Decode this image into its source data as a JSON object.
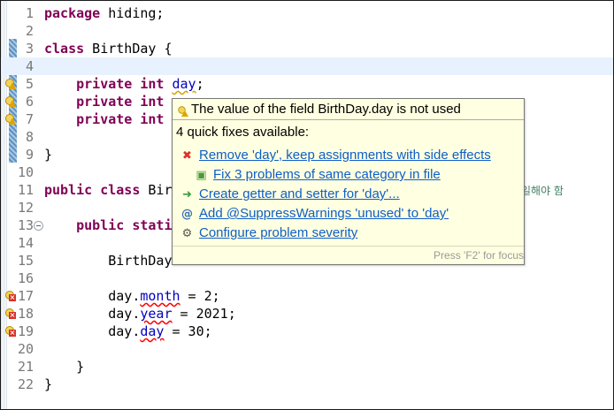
{
  "editor": {
    "lines": [
      {
        "num": "1",
        "tokens": [
          {
            "t": "package",
            "c": "kw"
          },
          {
            "t": " hiding;"
          }
        ]
      },
      {
        "num": "2",
        "tokens": []
      },
      {
        "num": "3",
        "tokens": [
          {
            "t": "class",
            "c": "kw"
          },
          {
            "t": " BirthDay {"
          }
        ]
      },
      {
        "num": "4",
        "tokens": [],
        "current": true
      },
      {
        "num": "5",
        "tokens": [
          {
            "t": "    "
          },
          {
            "t": "private",
            "c": "kw"
          },
          {
            "t": " "
          },
          {
            "t": "int",
            "c": "kw"
          },
          {
            "t": " "
          },
          {
            "t": "day",
            "c": "warnfld"
          },
          {
            "t": ";"
          }
        ],
        "gutter": "warn"
      },
      {
        "num": "6",
        "tokens": [
          {
            "t": "    "
          },
          {
            "t": "private",
            "c": "kw"
          },
          {
            "t": " "
          },
          {
            "t": "int",
            "c": "kw"
          }
        ],
        "gutter": "warn"
      },
      {
        "num": "7",
        "tokens": [
          {
            "t": "    "
          },
          {
            "t": "private",
            "c": "kw"
          },
          {
            "t": " "
          },
          {
            "t": "int",
            "c": "kw"
          }
        ],
        "gutter": "warn"
      },
      {
        "num": "8",
        "tokens": []
      },
      {
        "num": "9",
        "tokens": [
          {
            "t": "}"
          }
        ]
      },
      {
        "num": "10",
        "tokens": []
      },
      {
        "num": "11",
        "tokens": [
          {
            "t": "public",
            "c": "kw"
          },
          {
            "t": " "
          },
          {
            "t": "class",
            "c": "kw"
          },
          {
            "t": " Bir"
          }
        ]
      },
      {
        "num": "12",
        "tokens": []
      },
      {
        "num": "13",
        "tokens": [
          {
            "t": "    "
          },
          {
            "t": "public",
            "c": "kw"
          },
          {
            "t": " "
          },
          {
            "t": "stati",
            "c": "kw"
          }
        ],
        "fold": true
      },
      {
        "num": "14",
        "tokens": []
      },
      {
        "num": "15",
        "tokens": [
          {
            "t": "        BirthDay"
          }
        ]
      },
      {
        "num": "16",
        "tokens": []
      },
      {
        "num": "17",
        "tokens": [
          {
            "t": "        day."
          },
          {
            "t": "month",
            "c": "err"
          },
          {
            "t": " = 2;"
          }
        ],
        "gutter": "err"
      },
      {
        "num": "18",
        "tokens": [
          {
            "t": "        day."
          },
          {
            "t": "year",
            "c": "err"
          },
          {
            "t": " = 2021;"
          }
        ],
        "gutter": "err"
      },
      {
        "num": "19",
        "tokens": [
          {
            "t": "        day."
          },
          {
            "t": "day",
            "c": "err"
          },
          {
            "t": " = 30;"
          }
        ],
        "gutter": "err"
      },
      {
        "num": "20",
        "tokens": []
      },
      {
        "num": "21",
        "tokens": [
          {
            "t": "    }"
          }
        ]
      },
      {
        "num": "22",
        "tokens": [
          {
            "t": "}"
          }
        ]
      }
    ],
    "comment_fragment": "일해야 함"
  },
  "hover": {
    "title": "The value of the field BirthDay.day is not used",
    "count": "4 quick fixes available:",
    "fixes": [
      {
        "label": "Remove 'day', keep assignments with side effects",
        "icon": "remove-x-icon",
        "glyph": "✖",
        "color": "#d8332b"
      },
      {
        "label": "Fix 3 problems of same category in file",
        "icon": "multi-fix-icon",
        "glyph": "▣",
        "color": "#4a9a3a"
      },
      {
        "label": "Create getter and setter for 'day'...",
        "icon": "getter-setter-icon",
        "glyph": "➜",
        "color": "#3a9a3a"
      },
      {
        "label": "Add @SuppressWarnings 'unused' to 'day'",
        "icon": "annotation-icon",
        "glyph": "@",
        "color": "#3a6fb0"
      },
      {
        "label": "Configure problem severity",
        "icon": "configure-severity-icon",
        "glyph": "⚙",
        "color": "#555555"
      }
    ],
    "status": "Press 'F2' for focus"
  }
}
